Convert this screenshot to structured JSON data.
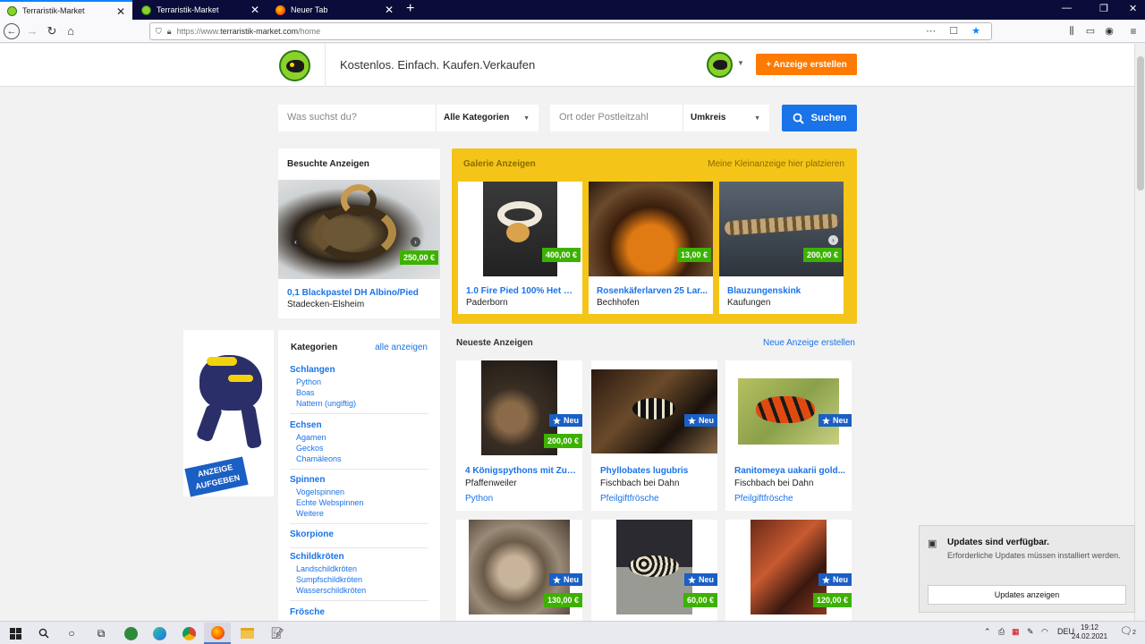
{
  "browser": {
    "tabs": [
      {
        "title": "Terraristik-Market",
        "active": true
      },
      {
        "title": "Terraristik-Market",
        "active": false
      },
      {
        "title": "Neuer Tab",
        "active": false
      }
    ],
    "url_prefix": "https://www.",
    "url_domain": "terraristik-market.com",
    "url_path": "/home"
  },
  "header": {
    "slogan": "Kostenlos. Einfach. Kaufen.Verkaufen",
    "create_button": "+ Anzeige erstellen"
  },
  "search": {
    "query_placeholder": "Was suchst du?",
    "category": "Alle Kategorien",
    "location_placeholder": "Ort oder Postleitzahl",
    "radius": "Umkreis",
    "button": "Suchen"
  },
  "visited": {
    "title": "Besuchte Anzeigen",
    "item": {
      "title": "0,1 Blackpastel DH Albino/Pied",
      "place": "Stadecken-Elsheim",
      "price": "250,00 €"
    }
  },
  "gallery": {
    "title": "Galerie Anzeigen",
    "promo": "Meine Kleinanzeige hier platzieren",
    "items": [
      {
        "title": "1.0 Fire Pied 100% Het G...",
        "place": "Paderborn",
        "price": "400,00 €"
      },
      {
        "title": "Rosenkäferlarven 25 Lar...",
        "place": "Bechhofen",
        "price": "13,00 €"
      },
      {
        "title": "Blauzungenskink",
        "place": "Kaufungen",
        "price": "200,00 €"
      }
    ]
  },
  "ad_banner": {
    "text_line1": "ANZEIGE",
    "text_line2": "AUFGEBEN"
  },
  "categories": {
    "title": "Kategorien",
    "show_all": "alle anzeigen",
    "groups": [
      {
        "name": "Schlangen",
        "subs": [
          "Python",
          "Boas",
          "Nattern (ungiftig)"
        ]
      },
      {
        "name": "Echsen",
        "subs": [
          "Agamen",
          "Geckos",
          "Chamäleons"
        ]
      },
      {
        "name": "Spinnen",
        "subs": [
          "Vogelspinnen",
          "Echte Webspinnen",
          "Weitere"
        ]
      },
      {
        "name": "Skorpione",
        "subs": []
      },
      {
        "name": "Schildkröten",
        "subs": [
          "Landschildkröten",
          "Sumpfschildkröten",
          "Wasserschildkröten"
        ]
      },
      {
        "name": "Frösche",
        "subs": []
      }
    ]
  },
  "newest": {
    "title": "Neueste Anzeigen",
    "create_link": "Neue Anzeige erstellen",
    "new_badge": "Neu",
    "items": [
      {
        "title": "4 Königspythons mit Zub...",
        "place": "Pfaffenweiler",
        "category": "Python",
        "price": "200,00 €"
      },
      {
        "title": "Phyllobates lugubris",
        "place": "Fischbach bei Dahn",
        "category": "Pfeilgiftfrösche",
        "price": ""
      },
      {
        "title": "Ranitomeya uakarii gold...",
        "place": "Fischbach bei Dahn",
        "category": "Pfeilgiftfrösche",
        "price": ""
      },
      {
        "title": "",
        "place": "",
        "category": "",
        "price": "130,00 €"
      },
      {
        "title": "",
        "place": "",
        "category": "",
        "price": "60,00 €"
      },
      {
        "title": "",
        "place": "",
        "category": "",
        "price": "120,00 €"
      }
    ]
  },
  "notification": {
    "title": "Updates sind verfügbar.",
    "body": "Erforderliche Updates müssen installiert werden.",
    "button": "Updates anzeigen"
  },
  "taskbar": {
    "lang": "DEU",
    "time": "19:12",
    "date": "24.02.2021",
    "notif_count": "2"
  }
}
